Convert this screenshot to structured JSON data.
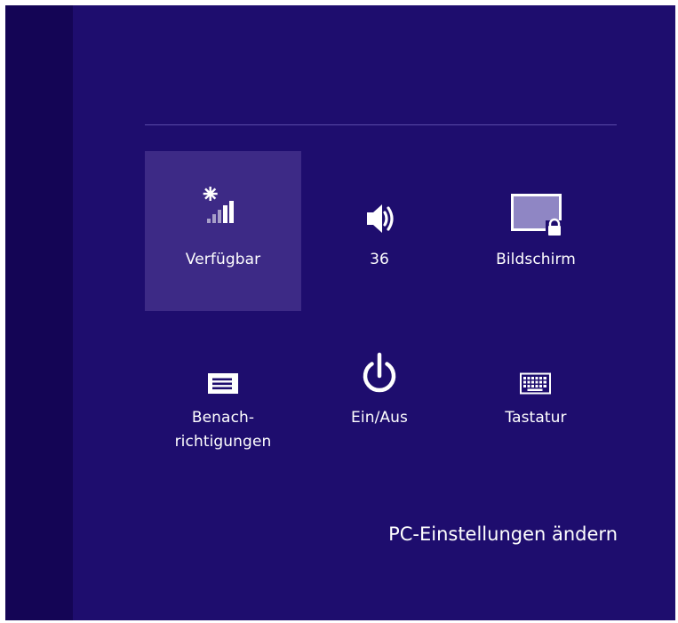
{
  "charm_settings": {
    "tiles": [
      {
        "id": "network",
        "icon": "wifi-signal-icon",
        "label": "Verfügbar",
        "selected": true
      },
      {
        "id": "volume",
        "icon": "speaker-icon",
        "label": "36"
      },
      {
        "id": "screen",
        "icon": "screen-lock-icon",
        "label": "Bildschirm"
      },
      {
        "id": "notifications",
        "icon": "notification-icon",
        "label_line1": "Benach-",
        "label_line2": "richtigungen"
      },
      {
        "id": "power",
        "icon": "power-icon",
        "label": "Ein/Aus"
      },
      {
        "id": "keyboard",
        "icon": "keyboard-icon",
        "label": "Tastatur"
      }
    ],
    "change_pc_settings": "PC-Einstellungen ändern"
  },
  "colors": {
    "background": "#1e0d6e",
    "left_strip": "#140555",
    "selected_tile": "#3d2a86",
    "divider": "#5a4aa8",
    "text": "#ffffff"
  }
}
